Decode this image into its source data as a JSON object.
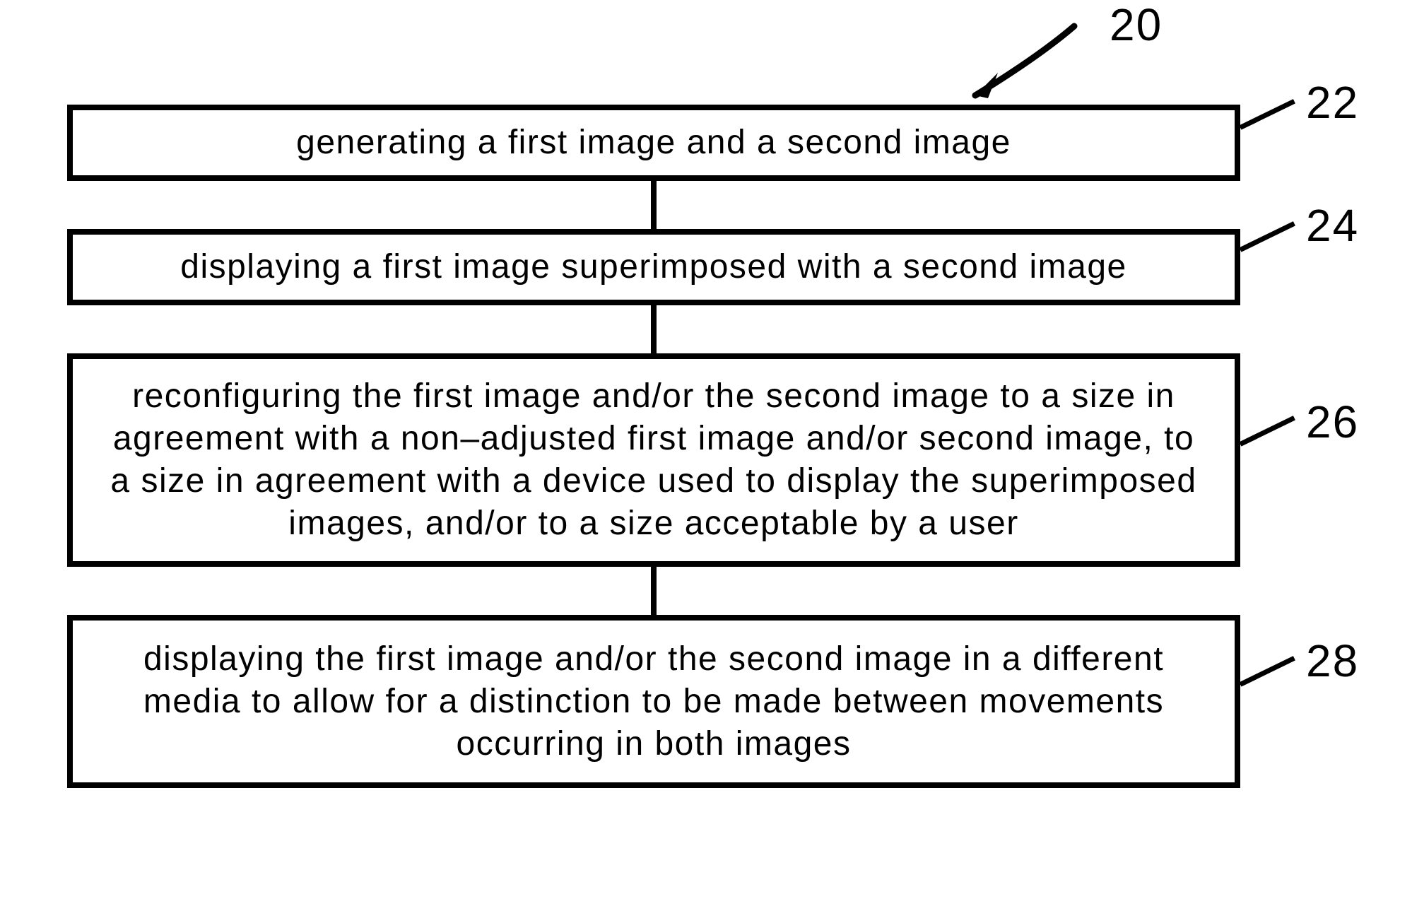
{
  "diagram": {
    "ref_main": "20",
    "steps": [
      {
        "ref": "22",
        "text": "generating a first image and a second image"
      },
      {
        "ref": "24",
        "text": "displaying a first image superimposed with a second image"
      },
      {
        "ref": "26",
        "text": "reconfiguring the first image and/or the second image to a size in agreement with a non–adjusted first image and/or second image, to a size in agreement with a device used to display the superimposed images, and/or to a size acceptable by a user"
      },
      {
        "ref": "28",
        "text": "displaying the first image and/or the second image in a different media to allow for a distinction to be made between movements occurring in both images"
      }
    ]
  }
}
